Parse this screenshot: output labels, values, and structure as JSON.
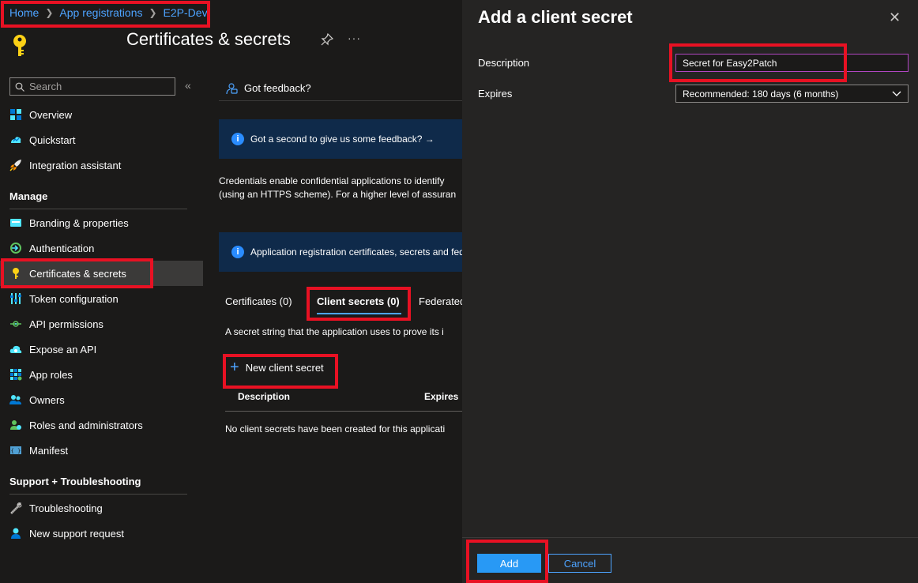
{
  "breadcrumb": {
    "items": [
      "Home",
      "App registrations",
      "E2P-Dev"
    ]
  },
  "page": {
    "title": "Certificates & secrets"
  },
  "sidebar": {
    "search_placeholder": "Search",
    "top_items": [
      {
        "label": "Overview",
        "icon": "overview-icon"
      },
      {
        "label": "Quickstart",
        "icon": "quickstart-icon"
      },
      {
        "label": "Integration assistant",
        "icon": "rocket-icon"
      }
    ],
    "manage_title": "Manage",
    "manage_items": [
      {
        "label": "Branding & properties",
        "icon": "branding-icon"
      },
      {
        "label": "Authentication",
        "icon": "authentication-icon"
      },
      {
        "label": "Certificates & secrets",
        "icon": "key-icon",
        "selected": true
      },
      {
        "label": "Token configuration",
        "icon": "token-icon"
      },
      {
        "label": "API permissions",
        "icon": "api-permissions-icon"
      },
      {
        "label": "Expose an API",
        "icon": "cloud-icon"
      },
      {
        "label": "App roles",
        "icon": "app-roles-icon"
      },
      {
        "label": "Owners",
        "icon": "owners-icon"
      },
      {
        "label": "Roles and administrators",
        "icon": "roles-icon"
      },
      {
        "label": "Manifest",
        "icon": "manifest-icon"
      }
    ],
    "support_title": "Support + Troubleshooting",
    "support_items": [
      {
        "label": "Troubleshooting",
        "icon": "wrench-icon"
      },
      {
        "label": "New support request",
        "icon": "support-person-icon"
      }
    ]
  },
  "main": {
    "feedback_label": "Got feedback?",
    "banner1": "Got a second to give us some feedback? →",
    "description_line1": "Credentials enable confidential applications to identify",
    "description_line2": "(using an HTTPS scheme). For a higher level of assuran",
    "banner2": "Application registration certificates, secrets and fed",
    "tabs": [
      "Certificates (0)",
      "Client secrets (0)",
      "Federated"
    ],
    "secret_info": "A secret string that the application uses to prove its i",
    "new_secret_label": "New client secret",
    "columns": [
      "Description",
      "Expires"
    ],
    "empty_message": "No client secrets have been created for this applicati"
  },
  "panel": {
    "title": "Add a client secret",
    "description_label": "Description",
    "description_value": "Secret for Easy2Patch",
    "expires_label": "Expires",
    "expires_value": "Recommended: 180 days (6 months)",
    "add_label": "Add",
    "cancel_label": "Cancel"
  },
  "colors": {
    "accent": "#2899f5",
    "highlight": "#e81123",
    "link": "#4da3ff"
  }
}
